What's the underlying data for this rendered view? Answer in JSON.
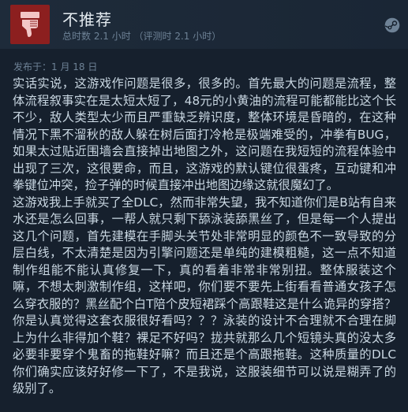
{
  "review": {
    "verdict": "不推荐",
    "hours_text": "总时数 2.1 小时 （评测时 2.1 小时）",
    "posted_date": "发布于：1 月 18 日",
    "paragraphs": [
      "实话实说，这游戏作问题是很多，很多的。首先最大的问题是流程，整体流程叙事实在是太短太短了，48元的小黄油的流程可能都能比这个长不少，敌人类型太少而且严重缺乏辨识度，整体环境是昏暗的，在这种情况下黑不溜秋的敌人躲在树后面打冷枪是极端难受的，冲拳有BUG，如果太过贴近围墙会直接掉出地图之外，这问题在我短短的流程体验中出现了三次，这很要命，而且，这游戏的默认键位很蛋疼，互动键和冲拳键位冲突，捡子弹的时候直接冲出地图边缘这就很魔幻了。",
      "这游戏我上手就买了全DLC，然而非常失望，我不知道你们是B站有自来水还是怎么回事，一帮人就只剩下舔泳装舔黑丝了，但是每一个人提出这几个问题，首先建模在手脚头关节处非常明显的颜色不一致导致的分层白线，不太清楚是因为引擎问题还是单纯的建模粗糙，这一点不知道制作组能不能认真修复一下，真的看着非常非常别扭。整体服装这个嘛，不想太刺激制作组，这样吧，你们要不要先上街看看普通女孩子怎么穿衣服的？黑丝配个白T陪个皮短裙踩个高跟鞋这是什么诡异的穿搭？你是认真觉得这套衣服很好看吗？？？泳装的设计不合理就不合理在脚上为什么非得加个鞋？裸足不好吗？拢共就那么几个短镜头真的没太多必要非要穿个鬼畜的拖鞋好嘛？而且还是个高跟拖鞋。这种质量的DLC你们确实应该好好修一下了，不是我说，这服装细节可以说是糊弄了的级别了。"
    ]
  },
  "icons": {
    "verdict": "thumbs-down-icon",
    "platform": "steam-icon"
  },
  "colors": {
    "background": "#16202d",
    "header": "#1e2b3a",
    "thumb_box": "#8c1f1f",
    "thumb_icon": "#f2c7c7",
    "title_text": "#e4ebf0",
    "muted_text": "#6e8296",
    "body_text": "#c9d7e2"
  }
}
